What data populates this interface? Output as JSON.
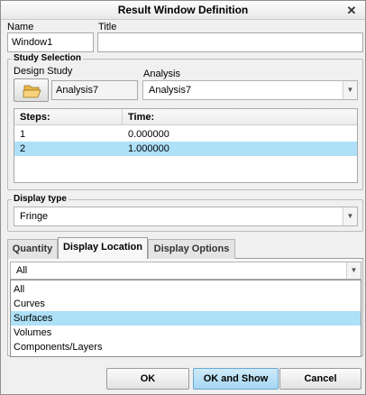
{
  "window": {
    "title": "Result Window Definition",
    "close_glyph": "✕"
  },
  "name": {
    "label": "Name",
    "value": "Window1"
  },
  "title_field": {
    "label": "Title",
    "value": ""
  },
  "study_selection": {
    "legend": "Study Selection",
    "design_study_label": "Design Study",
    "design_study_value": "Analysis7",
    "open_icon": "folder-open-icon",
    "analysis_label": "Analysis",
    "analysis_value": "Analysis7",
    "steps_header": "Steps:",
    "time_header": "Time:",
    "rows": [
      {
        "step": "1",
        "time": "0.000000"
      },
      {
        "step": "2",
        "time": "1.000000"
      }
    ],
    "selected_row": 1
  },
  "display_type": {
    "legend": "Display type",
    "value": "Fringe"
  },
  "tabs": [
    {
      "label": "Quantity",
      "active": false
    },
    {
      "label": "Display Location",
      "active": true
    },
    {
      "label": "Display Options",
      "active": false
    }
  ],
  "location_dropdown": {
    "value": "All",
    "options": [
      "All",
      "Curves",
      "Surfaces",
      "Volumes",
      "Components/Layers"
    ],
    "highlighted": "Surfaces"
  },
  "buttons": {
    "ok": "OK",
    "ok_and_show": "OK and Show",
    "cancel": "Cancel"
  },
  "colors": {
    "selection": "#aee0f8",
    "default_button": "#a6d6f2"
  }
}
